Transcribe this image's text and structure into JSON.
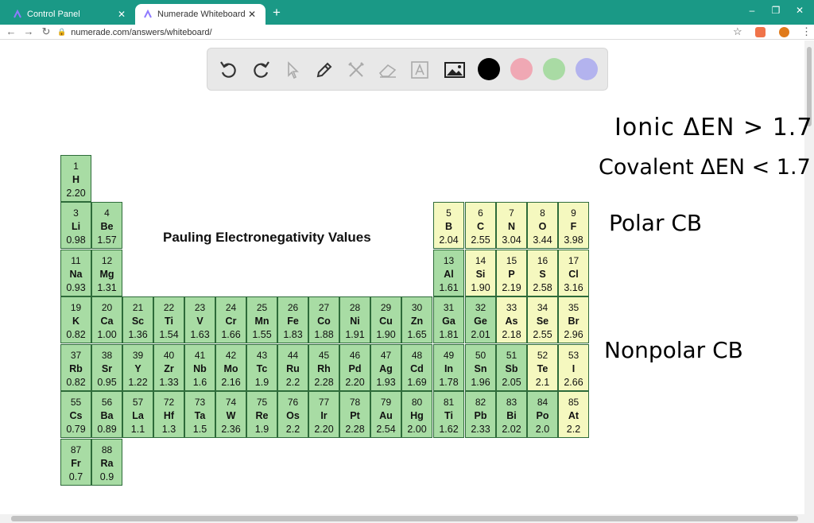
{
  "browser": {
    "tabs": [
      {
        "title": "Control Panel",
        "active": false,
        "favicon": "numerade-favicon-icon"
      },
      {
        "title": "Numerade Whiteboard",
        "active": true,
        "favicon": "numerade-favicon-icon"
      }
    ],
    "new_tab_symbol": "+",
    "window_controls": {
      "minimize": "–",
      "maximize": "❐",
      "close": "✕"
    },
    "address": "numerade.com/answers/whiteboard/",
    "accent": "#1a9986"
  },
  "toolbar": {
    "tools": [
      "undo-icon",
      "redo-icon",
      "pointer-icon",
      "pen-icon",
      "tools-icon",
      "eraser-icon",
      "text-icon",
      "image-icon"
    ],
    "colors": [
      "#000000",
      "#f0a8b4",
      "#a9dba4",
      "#b3b3ee"
    ]
  },
  "periodic_table": {
    "title": "Pauling Electronegativity Values",
    "elements": [
      {
        "n": "1",
        "s": "H",
        "en": "2.20",
        "c": "green"
      },
      {
        "n": "3",
        "s": "Li",
        "en": "0.98",
        "c": "green"
      },
      {
        "n": "4",
        "s": "Be",
        "en": "1.57",
        "c": "green"
      },
      {
        "n": "5",
        "s": "B",
        "en": "2.04",
        "c": "yellow"
      },
      {
        "n": "6",
        "s": "C",
        "en": "2.55",
        "c": "yellow"
      },
      {
        "n": "7",
        "s": "N",
        "en": "3.04",
        "c": "yellow"
      },
      {
        "n": "8",
        "s": "O",
        "en": "3.44",
        "c": "yellow"
      },
      {
        "n": "9",
        "s": "F",
        "en": "3.98",
        "c": "yellow"
      },
      {
        "n": "11",
        "s": "Na",
        "en": "0.93",
        "c": "green"
      },
      {
        "n": "12",
        "s": "Mg",
        "en": "1.31",
        "c": "green"
      },
      {
        "n": "13",
        "s": "Al",
        "en": "1.61",
        "c": "green"
      },
      {
        "n": "14",
        "s": "Si",
        "en": "1.90",
        "c": "yellow"
      },
      {
        "n": "15",
        "s": "P",
        "en": "2.19",
        "c": "yellow"
      },
      {
        "n": "16",
        "s": "S",
        "en": "2.58",
        "c": "yellow"
      },
      {
        "n": "17",
        "s": "Cl",
        "en": "3.16",
        "c": "yellow"
      },
      {
        "n": "19",
        "s": "K",
        "en": "0.82",
        "c": "green"
      },
      {
        "n": "20",
        "s": "Ca",
        "en": "1.00",
        "c": "green"
      },
      {
        "n": "21",
        "s": "Sc",
        "en": "1.36",
        "c": "green"
      },
      {
        "n": "22",
        "s": "Ti",
        "en": "1.54",
        "c": "green"
      },
      {
        "n": "23",
        "s": "V",
        "en": "1.63",
        "c": "green"
      },
      {
        "n": "24",
        "s": "Cr",
        "en": "1.66",
        "c": "green"
      },
      {
        "n": "25",
        "s": "Mn",
        "en": "1.55",
        "c": "green"
      },
      {
        "n": "26",
        "s": "Fe",
        "en": "1.83",
        "c": "green"
      },
      {
        "n": "27",
        "s": "Co",
        "en": "1.88",
        "c": "green"
      },
      {
        "n": "28",
        "s": "Ni",
        "en": "1.91",
        "c": "green"
      },
      {
        "n": "29",
        "s": "Cu",
        "en": "1.90",
        "c": "green"
      },
      {
        "n": "30",
        "s": "Zn",
        "en": "1.65",
        "c": "green"
      },
      {
        "n": "31",
        "s": "Ga",
        "en": "1.81",
        "c": "green"
      },
      {
        "n": "32",
        "s": "Ge",
        "en": "2.01",
        "c": "green"
      },
      {
        "n": "33",
        "s": "As",
        "en": "2.18",
        "c": "yellow"
      },
      {
        "n": "34",
        "s": "Se",
        "en": "2.55",
        "c": "yellow"
      },
      {
        "n": "35",
        "s": "Br",
        "en": "2.96",
        "c": "yellow"
      },
      {
        "n": "37",
        "s": "Rb",
        "en": "0.82",
        "c": "green"
      },
      {
        "n": "38",
        "s": "Sr",
        "en": "0.95",
        "c": "green"
      },
      {
        "n": "39",
        "s": "Y",
        "en": "1.22",
        "c": "green"
      },
      {
        "n": "40",
        "s": "Zr",
        "en": "1.33",
        "c": "green"
      },
      {
        "n": "41",
        "s": "Nb",
        "en": "1.6",
        "c": "green"
      },
      {
        "n": "42",
        "s": "Mo",
        "en": "2.16",
        "c": "green"
      },
      {
        "n": "43",
        "s": "Tc",
        "en": "1.9",
        "c": "green"
      },
      {
        "n": "44",
        "s": "Ru",
        "en": "2.2",
        "c": "green"
      },
      {
        "n": "45",
        "s": "Rh",
        "en": "2.28",
        "c": "green"
      },
      {
        "n": "46",
        "s": "Pd",
        "en": "2.20",
        "c": "green"
      },
      {
        "n": "47",
        "s": "Ag",
        "en": "1.93",
        "c": "green"
      },
      {
        "n": "48",
        "s": "Cd",
        "en": "1.69",
        "c": "green"
      },
      {
        "n": "49",
        "s": "In",
        "en": "1.78",
        "c": "green"
      },
      {
        "n": "50",
        "s": "Sn",
        "en": "1.96",
        "c": "green"
      },
      {
        "n": "51",
        "s": "Sb",
        "en": "2.05",
        "c": "green"
      },
      {
        "n": "52",
        "s": "Te",
        "en": "2.1",
        "c": "yellow"
      },
      {
        "n": "53",
        "s": "I",
        "en": "2.66",
        "c": "yellow"
      },
      {
        "n": "55",
        "s": "Cs",
        "en": "0.79",
        "c": "green"
      },
      {
        "n": "56",
        "s": "Ba",
        "en": "0.89",
        "c": "green"
      },
      {
        "n": "57",
        "s": "La",
        "en": "1.1",
        "c": "green"
      },
      {
        "n": "72",
        "s": "Hf",
        "en": "1.3",
        "c": "green"
      },
      {
        "n": "73",
        "s": "Ta",
        "en": "1.5",
        "c": "green"
      },
      {
        "n": "74",
        "s": "W",
        "en": "2.36",
        "c": "green"
      },
      {
        "n": "75",
        "s": "Re",
        "en": "1.9",
        "c": "green"
      },
      {
        "n": "76",
        "s": "Os",
        "en": "2.2",
        "c": "green"
      },
      {
        "n": "77",
        "s": "Ir",
        "en": "2.20",
        "c": "green"
      },
      {
        "n": "78",
        "s": "Pt",
        "en": "2.28",
        "c": "green"
      },
      {
        "n": "79",
        "s": "Au",
        "en": "2.54",
        "c": "green"
      },
      {
        "n": "80",
        "s": "Hg",
        "en": "2.00",
        "c": "green"
      },
      {
        "n": "81",
        "s": "Ti",
        "en": "1.62",
        "c": "green"
      },
      {
        "n": "82",
        "s": "Pb",
        "en": "2.33",
        "c": "green"
      },
      {
        "n": "83",
        "s": "Bi",
        "en": "2.02",
        "c": "green"
      },
      {
        "n": "84",
        "s": "Po",
        "en": "2.0",
        "c": "green"
      },
      {
        "n": "85",
        "s": "At",
        "en": "2.2",
        "c": "yellow"
      },
      {
        "n": "87",
        "s": "Fr",
        "en": "0.7",
        "c": "green"
      },
      {
        "n": "88",
        "s": "Ra",
        "en": "0.9",
        "c": "green"
      }
    ]
  },
  "handwritten_notes": [
    "Ionic ΔEN > 1.7",
    "Covalent ΔEN < 1.7",
    "Polar CB",
    "Nonpolar CB"
  ]
}
